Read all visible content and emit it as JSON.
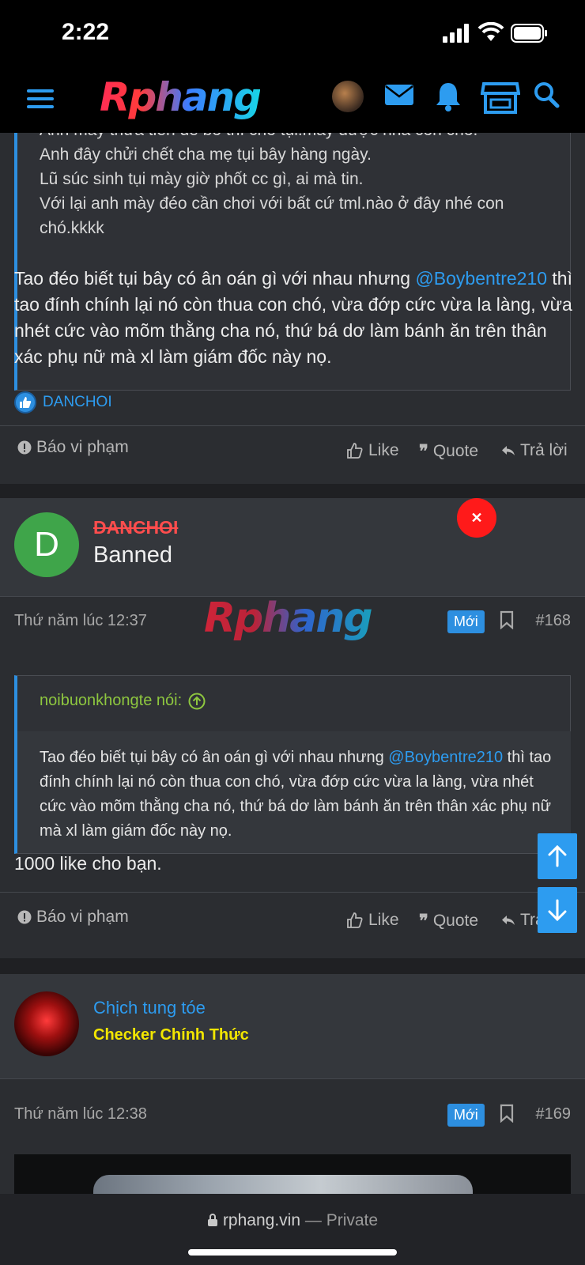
{
  "status": {
    "time": "2:22"
  },
  "header": {
    "logo": "Rphang"
  },
  "post1": {
    "quote_lines": [
      "Anh mày thừa tiền để bố thí cho tụi.mày được nha con chó.",
      "Anh đây chửi chết cha mẹ tụi bây hàng ngày.",
      "Lũ súc sinh tụi mày giờ phốt cc gì, ai mà tin.",
      "Với lại anh mày đéo cần chơi với bất cứ tml.nào ở đây nhé con chó.kkkk"
    ],
    "body_pre": "Tao đéo biết tụi bây có ân oán gì với nhau nhưng ",
    "mention": "@Boybentre210",
    "body_post": " thì tao đính chính lại nó còn thua con chó, vừa đớp cức vừa la làng, vừa nhét cức vào mõm thằng cha nó, thứ bá dơ làm bánh ăn trên thân xác phụ nữ mà xl làm giám đốc này nọ.",
    "reaction_user": "DANCHOI"
  },
  "actions": {
    "report": "Báo vi phạm",
    "like": "Like",
    "quote": "Quote",
    "reply": "Trả lời"
  },
  "post2": {
    "user_initial": "D",
    "username": "DANCHOI",
    "user_title": "Banned",
    "date": "Thứ năm lúc 12:37",
    "badge": "Mới",
    "number": "#168",
    "watermark": "Rphang",
    "quote_author": "noibuonkhongte nói:",
    "quote_pre": "Tao đéo biết tụi bây có ân oán gì với nhau nhưng ",
    "quote_mention": "@Boybentre210",
    "quote_post": " thì tao đính chính lại nó còn thua con chó, vừa đớp cức vừa la làng, vừa nhét cức vào mõm thằng cha nó, thứ bá dơ làm bánh ăn trên thân xác phụ nữ mà xl làm giám đốc này nọ.",
    "body": "1000 like cho bạn."
  },
  "post3": {
    "username": "Chịch tung tóe",
    "user_title": "Checker Chính Thức",
    "date": "Thứ năm lúc 12:38",
    "badge": "Mới",
    "number": "#169"
  },
  "browser": {
    "domain": "rphang.vin",
    "separator": " — ",
    "mode": "Private"
  },
  "colors": {
    "accent": "#2d9cf0",
    "banned_red": "#ff4d4d",
    "quote_green": "#8ec73f",
    "checker_yellow": "#f2e600"
  }
}
